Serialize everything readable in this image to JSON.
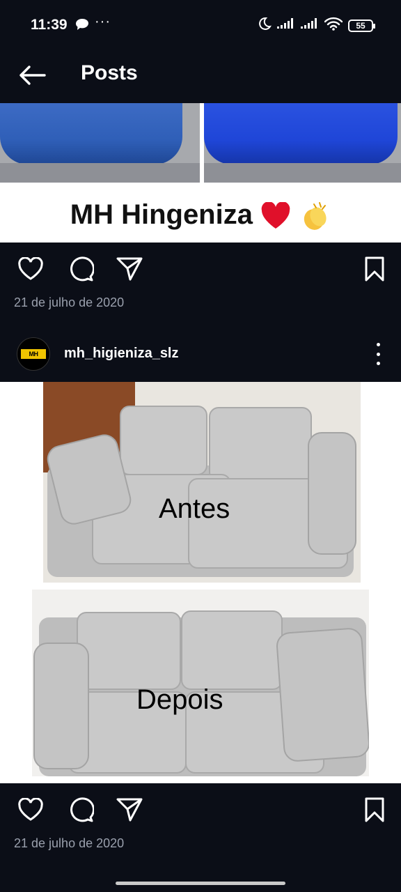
{
  "status_bar": {
    "time": "11:39",
    "overflow": "···",
    "battery": "55",
    "icons": [
      "chat-bubble-icon",
      "moon-icon",
      "signal-icon",
      "signal-icon",
      "wifi-icon",
      "battery-icon"
    ]
  },
  "header": {
    "title": "Posts",
    "back_icon": "arrow-left-icon"
  },
  "post1": {
    "caption": "MH Hingeniza",
    "caption_emojis": [
      "red-heart-icon",
      "clapping-hands-icon"
    ],
    "date": "21 de julho de 2020"
  },
  "post2": {
    "username": "mh_higieniza_slz",
    "avatar_text": "MH",
    "before_label": "Antes",
    "after_label": "Depois",
    "date": "21 de julho de 2020"
  },
  "actions": {
    "icons": [
      "heart-icon",
      "comment-icon",
      "share-icon",
      "bookmark-icon"
    ]
  },
  "colors": {
    "background": "#0b0e17",
    "date_text": "#9aa0ad",
    "heart": "#e0102a"
  }
}
